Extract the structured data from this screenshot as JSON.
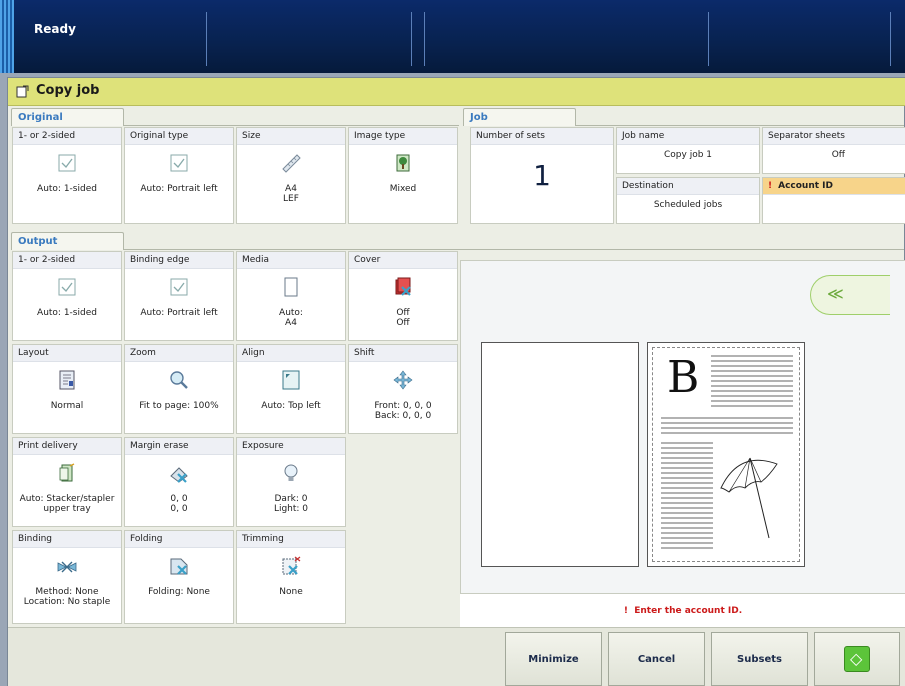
{
  "status": {
    "text": "Ready"
  },
  "title": "Copy job",
  "original": {
    "tab": "Original",
    "tiles": [
      {
        "label": "1- or 2-sided",
        "value": "Auto: 1-sided",
        "icon": "checkbox-icon"
      },
      {
        "label": "Original type",
        "value": "Auto: Portrait left",
        "icon": "checkbox-icon"
      },
      {
        "label": "Size",
        "value": "A4\nLEF",
        "icon": "ruler-icon"
      },
      {
        "label": "Image type",
        "value": "Mixed",
        "icon": "mixed-image-icon"
      }
    ]
  },
  "job": {
    "tab": "Job",
    "number_of_sets": {
      "label": "Number of sets",
      "value": "1"
    },
    "job_name": {
      "label": "Job name",
      "value": "Copy job 1"
    },
    "separator_sheets": {
      "label": "Separator sheets",
      "value": "Off"
    },
    "destination": {
      "label": "Destination",
      "value": "Scheduled jobs"
    },
    "account_id": {
      "label": "Account ID",
      "value": "",
      "warning": "!"
    }
  },
  "output": {
    "tab": "Output",
    "tiles": [
      {
        "label": "1- or 2-sided",
        "value": "Auto: 1-sided"
      },
      {
        "label": "Binding edge",
        "value": "Auto: Portrait left"
      },
      {
        "label": "Media",
        "value": "Auto:\nA4"
      },
      {
        "label": "Cover",
        "value": "Off\nOff"
      },
      {
        "label": "Layout",
        "value": "Normal"
      },
      {
        "label": "Zoom",
        "value": "Fit to page: 100%"
      },
      {
        "label": "Align",
        "value": "Auto: Top left"
      },
      {
        "label": "Shift",
        "value": "Front: 0, 0, 0\nBack: 0, 0, 0"
      },
      {
        "label": "Print delivery",
        "value": "Auto: Stacker/stapler\nupper tray"
      },
      {
        "label": "Margin erase",
        "value": "0, 0\n0, 0"
      },
      {
        "label": "Exposure",
        "value": "Dark: 0\nLight: 0"
      },
      {
        "label": "Binding",
        "value": "Method: None\nLocation: No staple"
      },
      {
        "label": "Folding",
        "value": "Folding: None"
      },
      {
        "label": "Trimming",
        "value": "None"
      }
    ]
  },
  "preview": {
    "collapse_glyph": "≪",
    "page_letter": "B",
    "message": "Enter the account ID.",
    "message_prefix": "!"
  },
  "buttons": {
    "minimize": "Minimize",
    "cancel": "Cancel",
    "subsets": "Subsets",
    "start_glyph": "◇"
  },
  "colors": {
    "title_bar": "#dee27a",
    "tab_text": "#3a7abf",
    "warning": "#cc1a1a",
    "start": "#5cc43a"
  }
}
